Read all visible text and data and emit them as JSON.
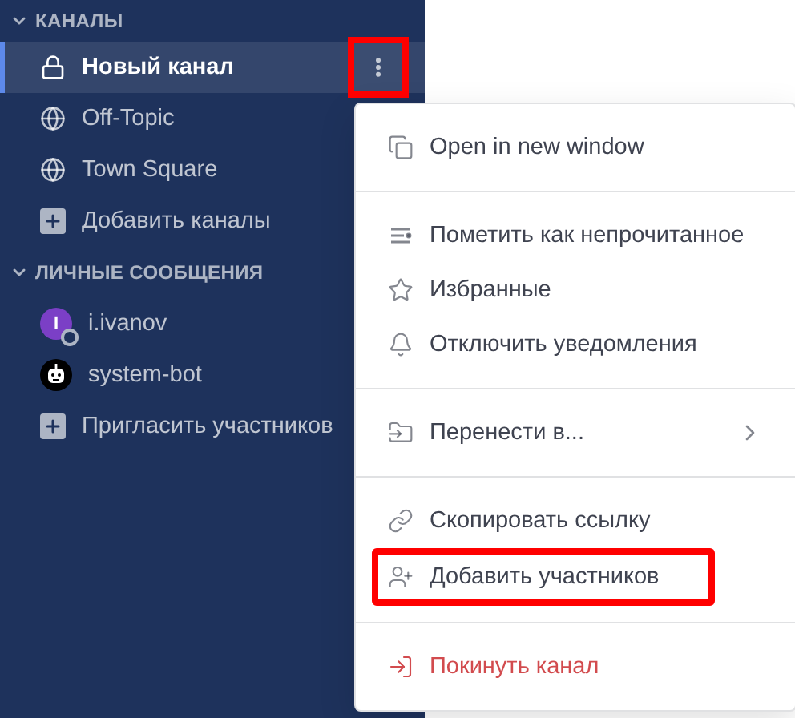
{
  "sidebar": {
    "sections": [
      {
        "title": "КАНАЛЫ",
        "expanded": true,
        "items": [
          {
            "kind": "private",
            "label": "Новый канал",
            "selected": true,
            "more_button": {
              "highlighted": true
            }
          },
          {
            "kind": "public",
            "label": "Off-Topic",
            "selected": false
          },
          {
            "kind": "public",
            "label": "Town Square",
            "selected": false
          },
          {
            "kind": "add",
            "label": "Добавить каналы",
            "selected": false
          }
        ]
      },
      {
        "title": "ЛИЧНЫЕ СООБЩЕНИЯ",
        "expanded": true,
        "items": [
          {
            "kind": "user",
            "label": "i.ivanov",
            "selected": false,
            "initial": "I",
            "color": "#7b3fc6"
          },
          {
            "kind": "bot",
            "label": "system-bot",
            "selected": false
          },
          {
            "kind": "add",
            "label": "Пригласить участников",
            "selected": false
          }
        ]
      }
    ]
  },
  "context_menu": {
    "groups": [
      [
        {
          "kind": "normal",
          "label": "Open in new window",
          "highlighted": false
        }
      ],
      [
        {
          "kind": "normal",
          "label": "Пометить как непрочитанное",
          "highlighted": false
        },
        {
          "kind": "normal",
          "label": "Избранные",
          "highlighted": false
        },
        {
          "kind": "normal",
          "label": "Отключить уведомления",
          "highlighted": false
        }
      ],
      [
        {
          "kind": "submenu",
          "label": "Перенести в...",
          "highlighted": false
        }
      ],
      [
        {
          "kind": "normal",
          "label": "Скопировать ссылку",
          "highlighted": false
        },
        {
          "kind": "normal",
          "label": "Добавить участников",
          "highlighted": true
        }
      ],
      [
        {
          "kind": "danger",
          "label": "Покинуть канал",
          "highlighted": false
        }
      ]
    ]
  }
}
